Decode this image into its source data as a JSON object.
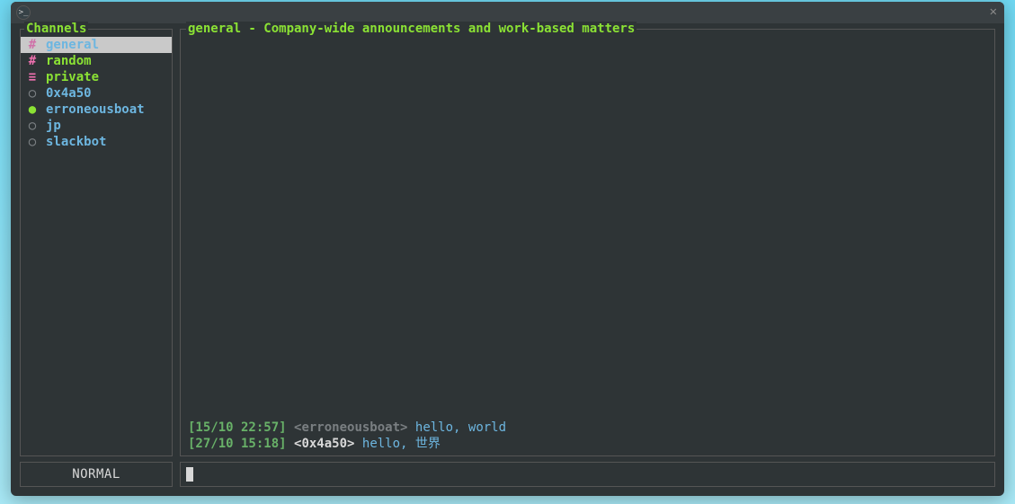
{
  "window": {
    "close_glyph": "✕",
    "prompt_glyph": ">_"
  },
  "sidebar": {
    "title": "Channels",
    "items": [
      {
        "marker": "#",
        "name": "general",
        "marker_color": "col-sel-marker",
        "name_color": "col-sel",
        "selected": true,
        "kind": "channel"
      },
      {
        "marker": "#",
        "name": "random",
        "marker_color": "col-pink",
        "name_color": "col-green",
        "selected": false,
        "kind": "channel"
      },
      {
        "marker": "≡",
        "name": "private",
        "marker_color": "col-pink",
        "name_color": "col-green",
        "selected": false,
        "kind": "group"
      },
      {
        "marker": "○",
        "name": "0x4a50",
        "marker_color": "col-grey",
        "name_color": "col-blue",
        "selected": false,
        "kind": "dm-offline"
      },
      {
        "marker": "●",
        "name": "erroneousboat",
        "marker_color": "col-green",
        "name_color": "col-blue",
        "selected": false,
        "kind": "dm-online"
      },
      {
        "marker": "○",
        "name": "jp",
        "marker_color": "col-grey",
        "name_color": "col-blue",
        "selected": false,
        "kind": "dm-offline"
      },
      {
        "marker": "○",
        "name": "slackbot",
        "marker_color": "col-grey",
        "name_color": "col-blue",
        "selected": false,
        "kind": "dm-offline"
      }
    ]
  },
  "chat": {
    "header": "general - Company-wide announcements and work-based matters",
    "messages": [
      {
        "ts": "[15/10 22:57]",
        "author": "<erroneousboat>",
        "author_style": "dim",
        "text": "hello, world"
      },
      {
        "ts": "[27/10 15:18]",
        "author": "<0x4a50>",
        "author_style": "bold",
        "text": "hello, 世界"
      }
    ]
  },
  "mode": {
    "label": "NORMAL"
  },
  "input": {
    "value": ""
  },
  "colors": {
    "bg": "#2e3436",
    "border": "#555555",
    "accent_green": "#8be234",
    "accent_blue": "#6db6e0",
    "accent_pink": "#f070b0",
    "dim": "#7a7f82"
  }
}
